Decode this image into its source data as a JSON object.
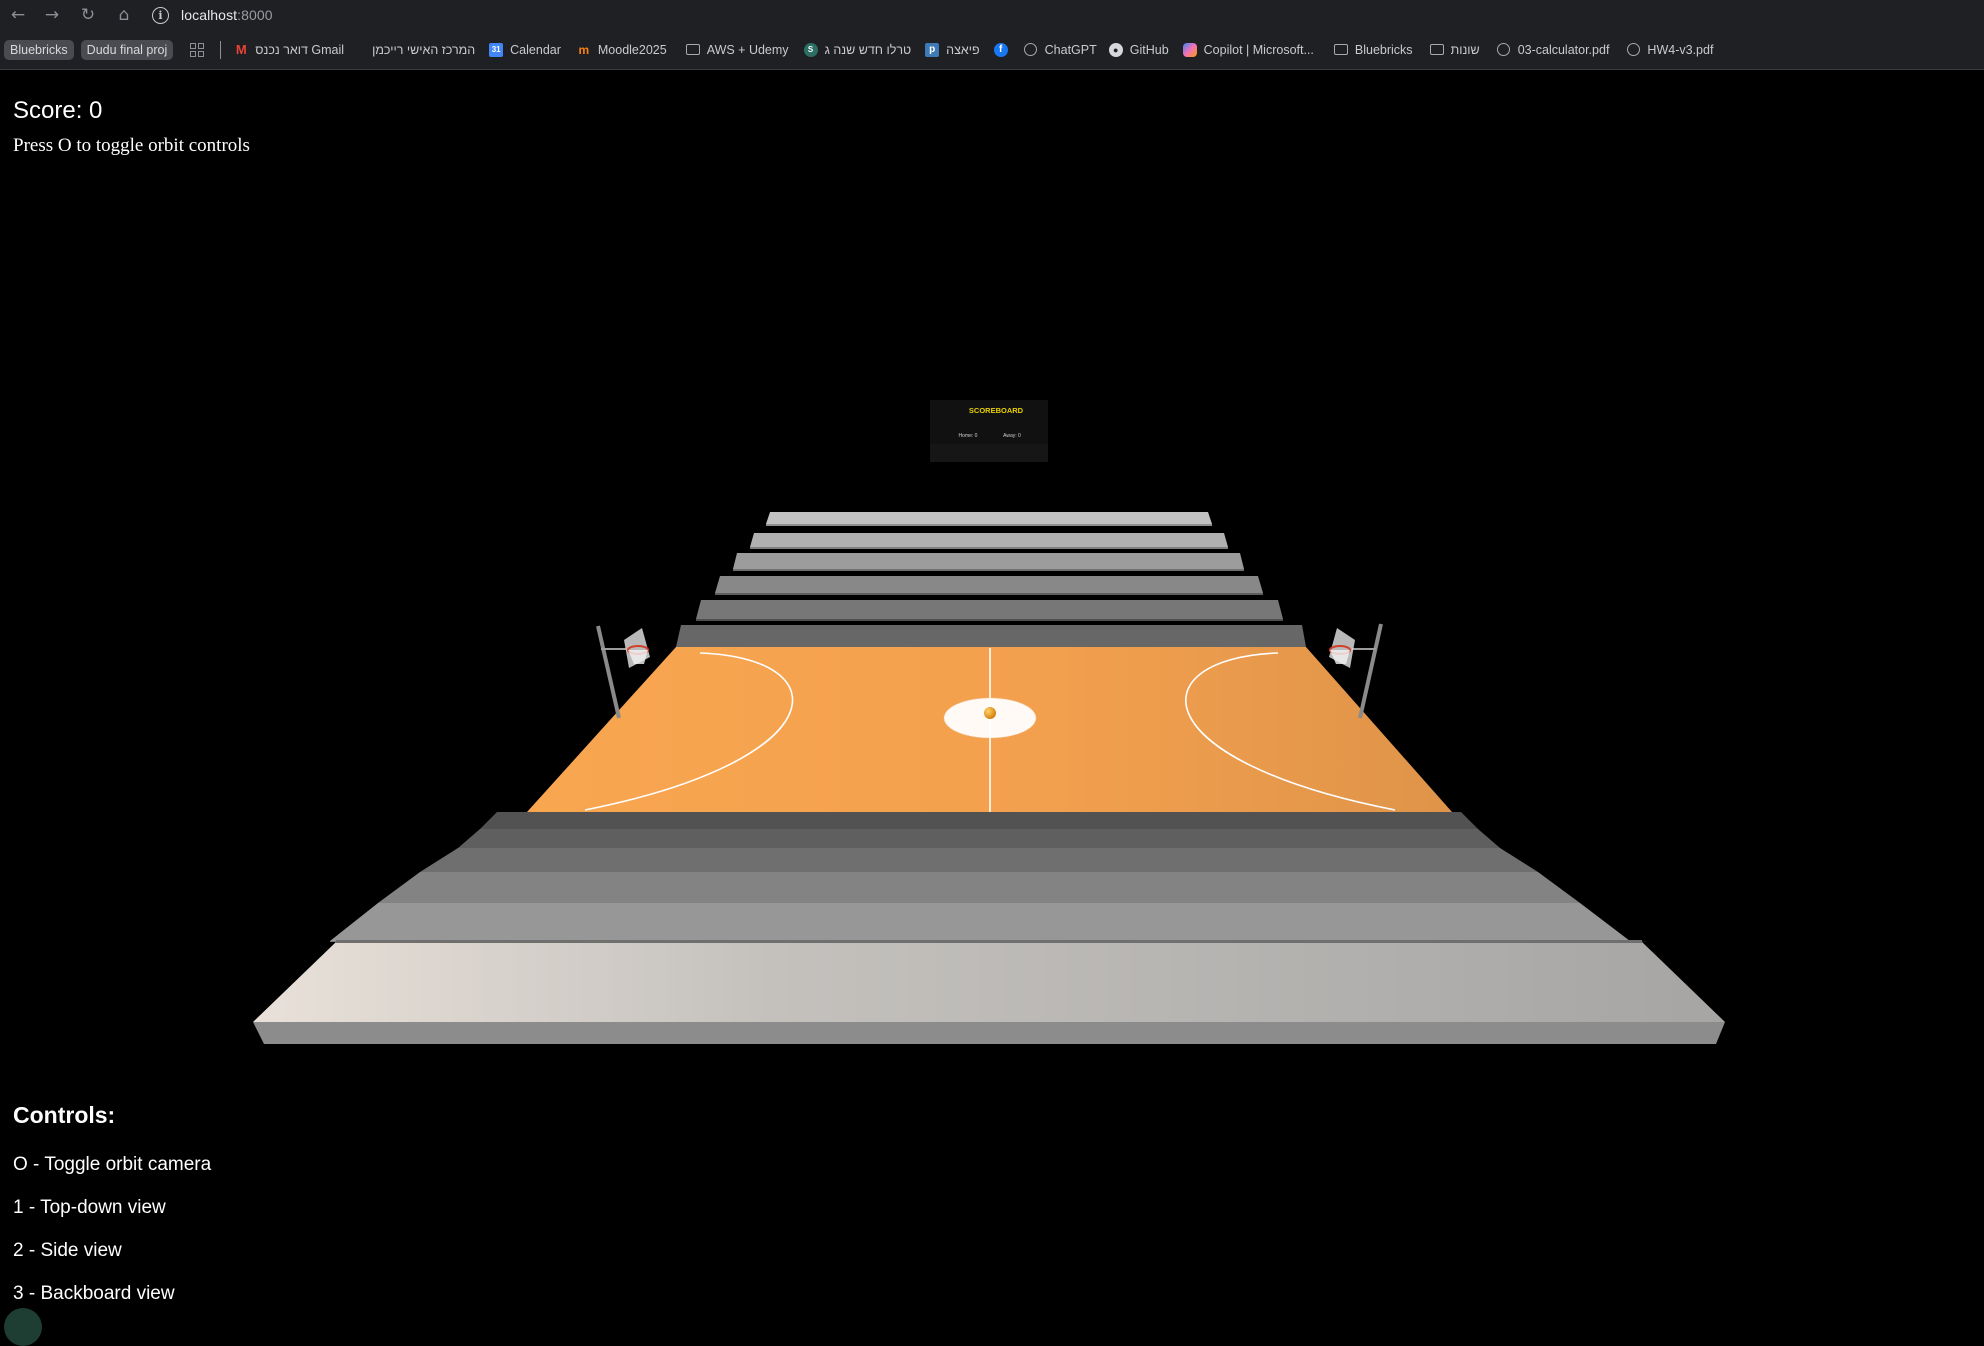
{
  "browser": {
    "nav": {
      "back_icon": "arrow-left-icon",
      "forward_icon": "arrow-right-icon",
      "reload_icon": "reload-icon",
      "home_icon": "home-icon"
    },
    "url_host": "localhost",
    "url_port": ":8000",
    "bookmarks": [
      {
        "label": "Bluebricks",
        "type": "pill"
      },
      {
        "label": "Dudu final proj",
        "type": "pill"
      },
      {
        "label": "דואר נכנס Gmail",
        "icon": "gmail-icon"
      },
      {
        "label": "המרכז האישי רייכמן",
        "icon": "blank-icon"
      },
      {
        "label": "Calendar",
        "icon": "calendar-icon"
      },
      {
        "label": "Moodle2025",
        "icon": "moodle-icon"
      },
      {
        "label": "AWS + Udemy",
        "icon": "folder-icon"
      },
      {
        "label": "טרלו חדש שנה ג",
        "icon": "trello-icon"
      },
      {
        "label": "פיאצה",
        "icon": "piazza-icon"
      },
      {
        "label": "",
        "icon": "facebook-icon"
      },
      {
        "label": "ChatGPT",
        "icon": "chatgpt-icon"
      },
      {
        "label": "GitHub",
        "icon": "github-icon"
      },
      {
        "label": "Copilot | Microsoft...",
        "icon": "copilot-icon"
      },
      {
        "label": "Bluebricks",
        "icon": "folder-icon"
      },
      {
        "label": "שונות",
        "icon": "folder-icon"
      },
      {
        "label": "03-calculator.pdf",
        "icon": "globe-icon"
      },
      {
        "label": "HW4-v3.pdf",
        "icon": "globe-icon"
      }
    ]
  },
  "hud": {
    "score": "Score: 0",
    "hint": "Press O to toggle orbit controls"
  },
  "controls": {
    "title": "Controls:",
    "items": [
      "O - Toggle orbit camera",
      "1 - Top-down view",
      "2 - Side view",
      "3 - Backboard view"
    ]
  },
  "scene": {
    "scoreboard_title": "SCOREBOARD",
    "scoreboard_home": "Home: 0",
    "scoreboard_away": "Away: 0",
    "colors": {
      "court": "#f7a44f",
      "court_dark": "#e09448",
      "ball": "#f08a10",
      "lines": "#ffffff",
      "scoreboard_text": "#e8d000",
      "background": "#000000"
    }
  }
}
